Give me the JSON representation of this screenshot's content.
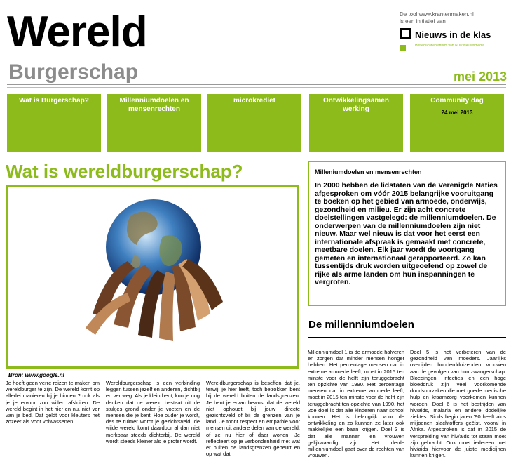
{
  "masthead": {
    "title": "Wereld",
    "subtitle": "Burgerschap",
    "date": "mei 2013"
  },
  "branding": {
    "tool_line1": "De tool www.krantenmaken.nl",
    "tool_line2": "is een initiatief van",
    "logo_name": "Nieuws in de klas",
    "logo_sub": "Het educatieplatform van NDP Nieuwsmedia"
  },
  "nav": [
    {
      "label": "Wat is Burgerschap?"
    },
    {
      "label": "Millenniumdoelen en mensenrechten"
    },
    {
      "label": "microkrediet"
    },
    {
      "label": "Ontwikkelingsamen werking"
    },
    {
      "label": "Community dag",
      "sub": "24 mei 2013"
    }
  ],
  "article": {
    "headline": "Wat is wereldburgerschap?",
    "image_icon": "globe-hands-image",
    "image_credit": "Bron: www.google.nl",
    "col1": "Je hoeft geen verre reizen te maken om wereldburger te zijn. De wereld komt op allerlei manieren bij je binnen ? ook als je je ervoor zou willen afsluiten. De wereld begint in het hier en nu, niet ver van je bed. Dat geldt voor kleuters net zozeer als voor volwassenen.",
    "col2": "Wereldburgerschap is een verbinding leggen tussen jezelf en anderen, dichtbij en ver weg. Als je klein bent, kun je nog denken dat de wereld bestaat uit de stukjes grond onder je voeten en de mensen die je kent. Hoe ouder je wordt, des te ruimer wordt je gezichtsveld: de wijde wereld komt daardoor al dan niet merkbaar steeds dichterbij. De wereld wordt steeds kleiner als je groter wordt.",
    "col3": "Wereldburgerschap is beseffen dat je, terwijl je hier leeft, toch betrokken bent bij de wereld buiten de landsgrenzen. Je bent je ervan bewust dat de wereld niet ophoudt bij jouw directe gezichtsveld of bij de grenzen van je land. Je toont respect en empathie voor mensen uit andere delen van de wereld, of ze nu hier of daar wonen. Je reflecteert op je verbondenheid met wat er buiten de landsgrenzen gebeurt en op wat dat"
  },
  "mdg_box": {
    "title": "Milleniumdoelen en mensenrechten",
    "text": "In 2000 hebben de lidstaten van de Verenigde Naties afgesproken om vóór 2015 belangrijke vooruitgang te boeken op het gebied van armoede, onderwijs, gezondheid en milieu. Er zijn acht concrete doelstellingen vastgelegd: de millenniumdoelen. De onderwerpen van de millenniumdoelen zijn niet nieuw. Maar wel nieuw is dat voor het eerst een internationale afspraak is gemaakt met concrete, meetbare doelen. Elk jaar wordt de voortgang gemeten en internationaal gerapporteerd. Zo kan tussentijds druk worden uitgeoefend op zowel de rijke als arme landen om hun inspanningen te vergroten."
  },
  "mdg": {
    "heading": "De millenniumdoelen",
    "col1": "Millenniumdoel 1 is de armoede halveren en zorgen dat minder mensen honger hebben. Het percentage mensen dat in extreme armoede leeft, moet in 2015 ten minste voor de helft zijn teruggebracht ten opzichte van 1990. Het percentage mensen dat in extreme armoede leeft, moet in 2015 ten minste voor de helft zijn teruggebracht ten opzichte van 1990. het 2de doel is dat alle kinderen naar school kunnen. Het is belangrijk voor de ontwikkeling en zo kunnen ze later ook makkelijke een baan krijgen. Doel 3 is dat alle mannen en vrouwen gelijkwaardig zijn. Het derde millenniumdoel gaat over de rechten van vrouwen.",
    "col2": "Doel 5 is het verbeteren van de gezondheid van moeders. Jaarlijks overlijden honderdduizenden vrouwen aan de gevolgen van hun zwangerschap. Bloedingen, infecties en een hoge bloeddruk zijn veel voorkomende doodsoorzaken die met goede medische hulp en kraamzorg voorkomen kunnen worden. Doel 6 is het bestrijden van hiv/aids, malaria en andere dodelijke ziektes. Sinds begin jaren '90 heeft aids miljoenen slachtoffers geëist, vooral in Afrika. Afgesproken is dat in 2015 de verspreiding van hiv/aids tot staan moet zijn gebracht. Ook moet iedereen met hiv/aids hiervoor de juiste medicijnen kunnen krijgen."
  }
}
